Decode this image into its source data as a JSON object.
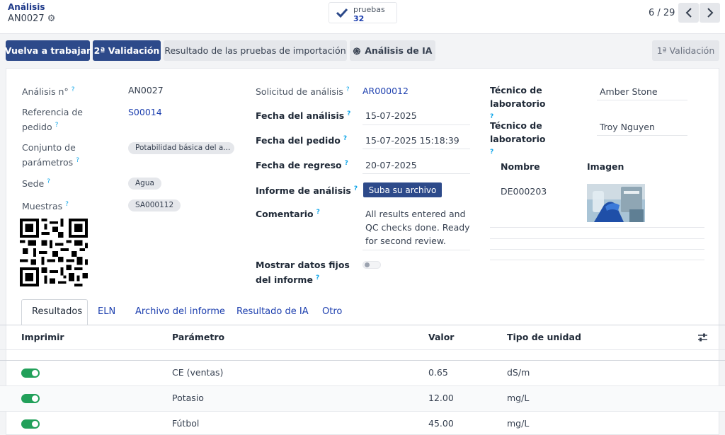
{
  "breadcrumb": {
    "parent": "Análisis",
    "record": "AN0027"
  },
  "smart_button": {
    "label": "pruebas",
    "count": "32"
  },
  "pager": {
    "text": "6 / 29"
  },
  "actions": {
    "rework": "Vuelva a trabajar",
    "second_validation": "2ª Validación",
    "import_results": "Resultado de las pruebas de importación",
    "ai_analysis": "Análisis de IA",
    "first_validation": "1ª Validación"
  },
  "form": {
    "analysis_no": {
      "label": "Análisis n°",
      "value": "AN0027"
    },
    "order_ref": {
      "label": "Referencia de pedido",
      "value": "S00014"
    },
    "param_set": {
      "label": "Conjunto de parámetros",
      "value": "Potabilidad básica del a..."
    },
    "site": {
      "label": "Sede",
      "value": "Agua"
    },
    "samples": {
      "label": "Muestras",
      "value": "SA000112"
    },
    "request": {
      "label": "Solicitud de análisis",
      "value": "AR000012"
    },
    "analysis_date": {
      "label": "Fecha del análisis",
      "value": "15-07-2025"
    },
    "order_date": {
      "label": "Fecha del pedido",
      "value": "15-07-2025 15:18:39"
    },
    "return_date": {
      "label": "Fecha de regreso",
      "value": "20-07-2025"
    },
    "report": {
      "label": "Informe de análisis",
      "button": "Suba su archivo"
    },
    "comment": {
      "label": "Comentario",
      "value": "All results entered and QC checks done. Ready for second review."
    },
    "show_fixed": {
      "label": "Mostrar datos fijos del informe"
    },
    "tech1": {
      "label": "Técnico de laboratorio",
      "value": "Amber Stone"
    },
    "tech2": {
      "label": "Técnico de laboratorio",
      "value": "Troy Nguyen"
    },
    "attachments": {
      "col_name": "Nombre",
      "col_image": "Imagen",
      "rows": [
        {
          "name": "DE000203"
        }
      ]
    }
  },
  "tabs": [
    "Resultados",
    "ELN",
    "Archivo del informe",
    "Resultado de IA",
    "Otro"
  ],
  "results_table": {
    "headers": {
      "print": "Imprimir",
      "param": "Parámetro",
      "value": "Valor",
      "unit": "Tipo de unidad"
    },
    "rows": [
      {
        "param": "CE (ventas)",
        "value": "0.65",
        "unit": "dS/m",
        "print": true
      },
      {
        "param": "Potasio",
        "value": "12.00",
        "unit": "mg/L",
        "print": true
      },
      {
        "param": "Fútbol",
        "value": "45.00",
        "unit": "mg/L",
        "print": true
      }
    ]
  },
  "colors": {
    "primary": "#2d4a8a",
    "link": "#1e40af",
    "toggle_on": "#22a05a",
    "help": "#0ea5e9"
  }
}
